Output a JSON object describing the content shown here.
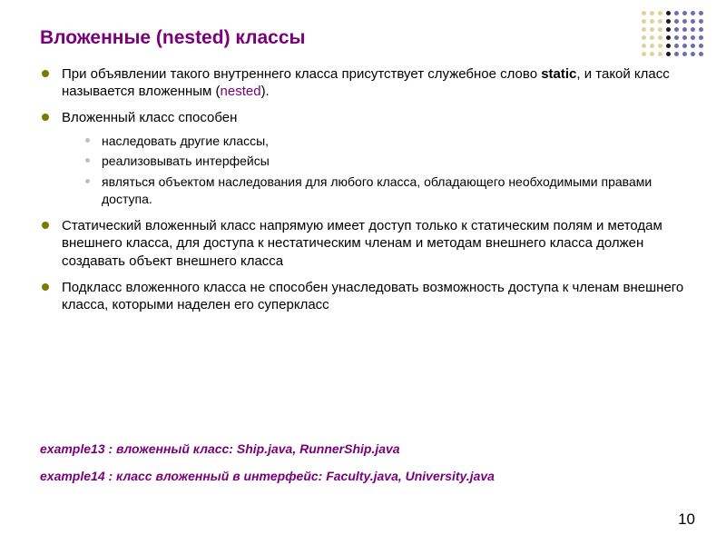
{
  "title": "Вложенные (nested) классы",
  "bullets": {
    "b1_pre": "При объявлении такого внутреннего класса присутствует служебное слово ",
    "b1_static": "static",
    "b1_mid": ", и такой класс называется вложенным (",
    "b1_nested": "nested",
    "b1_post": ").",
    "b2": "Вложенный класс способен",
    "b2_sub1": "наследовать другие классы,",
    "b2_sub2": "реализовывать интерфейсы",
    "b2_sub3": "являться объектом наследования для любого класса, обладающего необходимыми правами доступа.",
    "b3": "Статический вложенный класс напрямую имеет доступ только к статическим полям и методам внешнего класса, для доступа к нестатическим членам и методам внешнего класса должен создавать объект внешнего класса",
    "b4": "Подкласс вложенного класса не способен унаследовать возможность доступа к членам внешнего класса, которыми наделен его суперкласс"
  },
  "examples": {
    "e1": "example13 :  вложенный класс: Ship.java, RunnerShip.java",
    "e2": "example14 :  класс вложенный в интерфейс: Faculty.java, University.java"
  },
  "page_number": "10",
  "dot_colors": [
    "#dcd49a",
    "#dcd49a",
    "#dcd49a",
    "#1a1a1a",
    "#6d6db0",
    "#6d6db0",
    "#6d6db0",
    "#6d6db0",
    "#dcd49a",
    "#dcd49a",
    "#dcd49a",
    "#1a1a1a",
    "#6d6db0",
    "#6d6db0",
    "#6d6db0",
    "#6d6db0",
    "#dcd49a",
    "#dcd49a",
    "#dcd49a",
    "#1a1a1a",
    "#6d6db0",
    "#6d6db0",
    "#6d6db0",
    "#6d6db0",
    "#dcd49a",
    "#dcd49a",
    "#dcd49a",
    "#1a1a1a",
    "#6d6db0",
    "#6d6db0",
    "#6d6db0",
    "#6d6db0",
    "#dcd49a",
    "#dcd49a",
    "#dcd49a",
    "#1a1a1a",
    "#6d6db0",
    "#6d6db0",
    "#6d6db0",
    "#6d6db0",
    "#dcd49a",
    "#dcd49a",
    "#dcd49a",
    "#1a1a1a",
    "#6d6db0",
    "#6d6db0",
    "#6d6db0",
    "#6d6db0"
  ]
}
